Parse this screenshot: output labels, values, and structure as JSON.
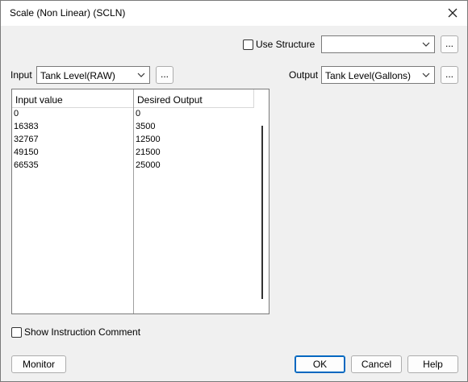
{
  "window": {
    "title": "Scale (Non Linear) (SCLN)"
  },
  "use_structure": {
    "label": "Use Structure",
    "checked": false,
    "value": ""
  },
  "input": {
    "label": "Input",
    "value": "Tank Level(RAW)"
  },
  "output": {
    "label": "Output",
    "value": "Tank Level(Gallons)"
  },
  "ellipsis_label": "...",
  "table": {
    "columns": [
      "Input value",
      "Desired Output"
    ],
    "rows": [
      [
        "0",
        "0"
      ],
      [
        "16383",
        "3500"
      ],
      [
        "32767",
        "12500"
      ],
      [
        "49150",
        "21500"
      ],
      [
        "66535",
        "25000"
      ]
    ]
  },
  "show_comment": {
    "label": "Show Instruction Comment",
    "checked": false
  },
  "buttons": {
    "monitor": "Monitor",
    "ok": "OK",
    "cancel": "Cancel",
    "help": "Help"
  },
  "icons": {
    "close": "close-icon",
    "dropdown": "chevron-down-icon"
  }
}
